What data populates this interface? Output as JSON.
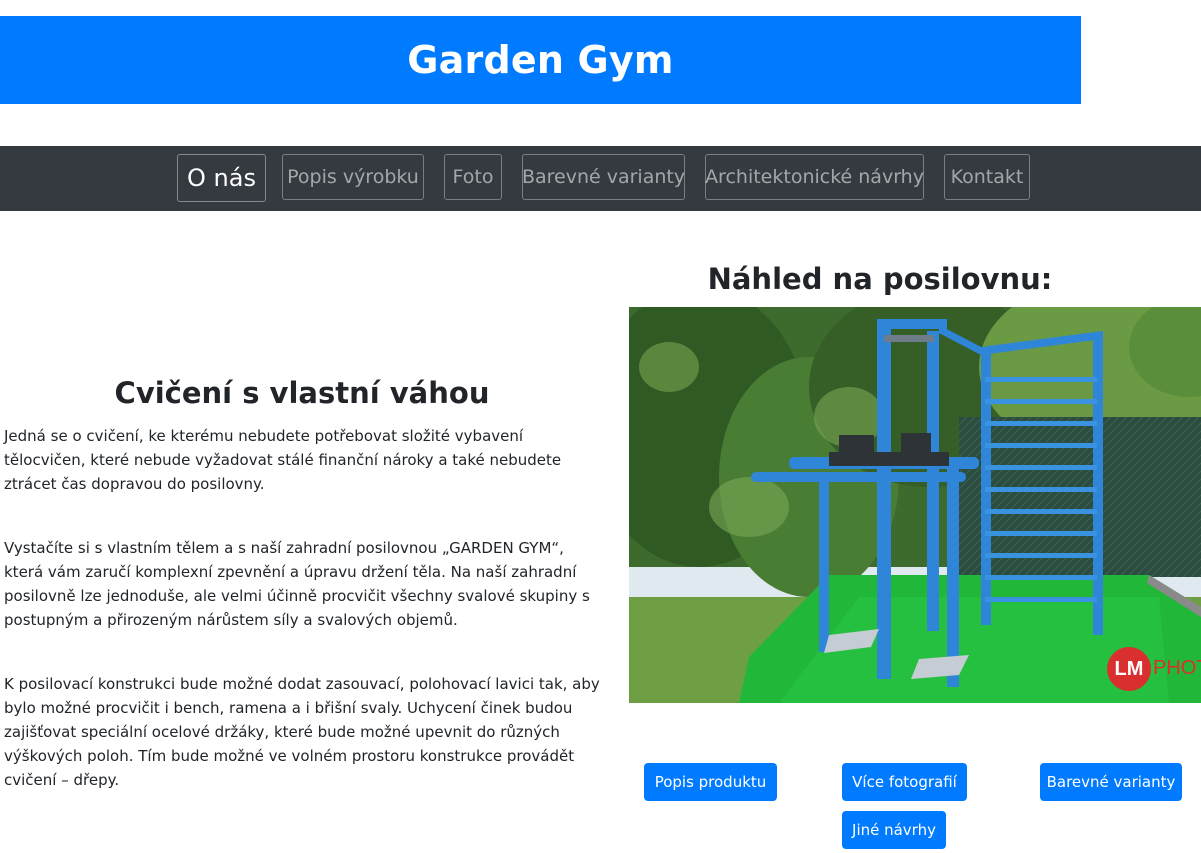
{
  "header": {
    "title": "Garden Gym"
  },
  "nav": {
    "items": [
      {
        "label": "O nás",
        "active": true
      },
      {
        "label": "Popis výrobku",
        "active": false
      },
      {
        "label": "Foto",
        "active": false
      },
      {
        "label": "Barevné varianty",
        "active": false
      },
      {
        "label": "Architektonické návrhy",
        "active": false
      },
      {
        "label": "Kontakt",
        "active": false
      }
    ]
  },
  "main": {
    "heading": "Cvičení s vlastní váhou",
    "paragraphs": [
      "Jedná se o cvičení, ke kterému nebudete potřebovat složité vybavení tělocvičen, které nebude vyžadovat stálé finanční nároky a také nebudete ztrácet čas dopravou do posilovny.",
      "Vystačíte si s vlastním tělem a s naší zahradní posilovnou „GARDEN GYM“, která vám zaručí komplexní zpevnění a úpravu držení těla. Na naší zahradní posilovně lze jednoduše, ale velmi účinně procvičit všechny svalové skupiny s postupným a přirozeným nárůstem síly a svalových objemů.",
      "K posilovací konstrukci bude možné dodat zasouvací, polohovací lavici tak, aby bylo možné procvičit i bench, ramena a i břišní svaly. Uchycení činek budou zajišťovat speciální ocelové držáky, které bude možné upevnit do různých výškových poloh. Tím bude možné ve volném prostoru konstrukce provádět cvičení – dřepy."
    ]
  },
  "preview": {
    "heading": "Náhled na posilovnu:",
    "watermark_badge": "LM",
    "watermark_text": "PHOTO"
  },
  "buttons": {
    "product": "Popis produktu",
    "photos": "Více fotografií",
    "colors": "Barevné varianty",
    "designs": "Jiné návrhy"
  },
  "colors": {
    "primary": "#007bff",
    "navbar": "#343a40",
    "frame_blue": "#2f86d9",
    "turf_green": "#1fae3a"
  }
}
